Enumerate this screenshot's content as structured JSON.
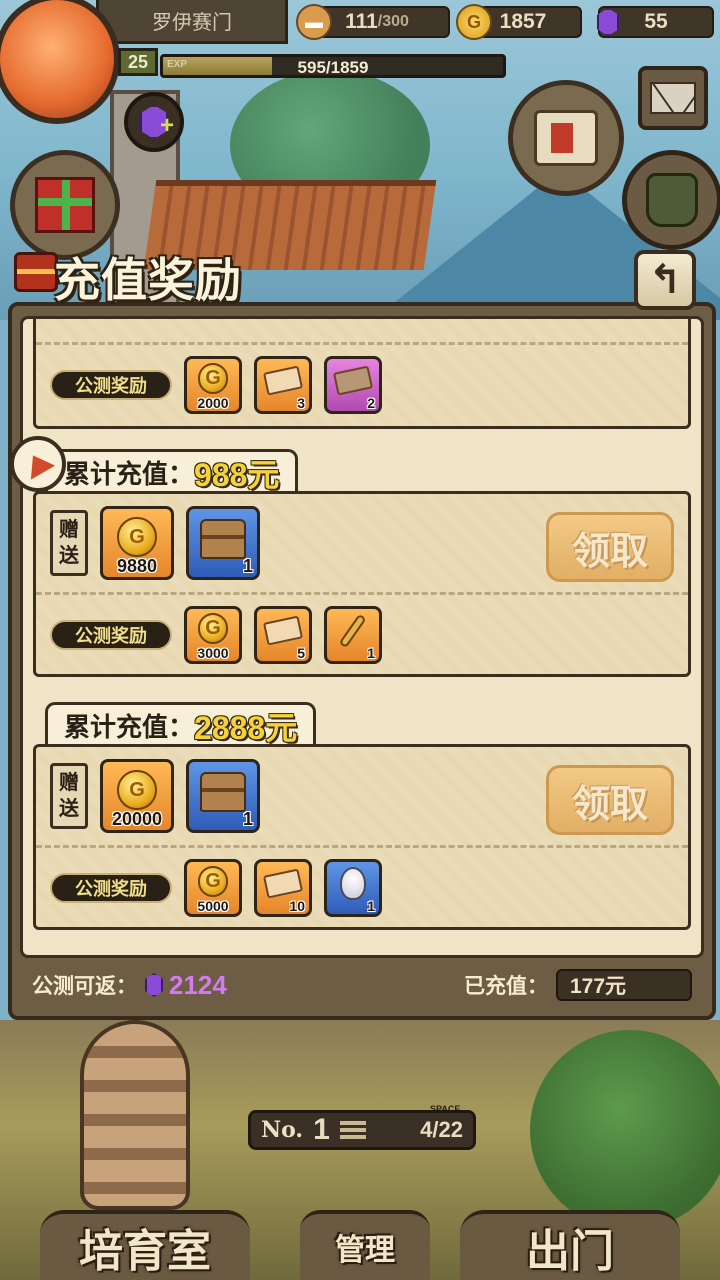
{
  "header": {
    "player_name": "罗伊赛门",
    "level": "25",
    "exp_label": "EXP",
    "exp_text": "595/1859",
    "exp_ratio": 0.32
  },
  "resources": {
    "bread": {
      "value": "111",
      "max": "/300"
    },
    "gold": {
      "value": "1857",
      "icon_text": "G"
    },
    "gems": {
      "value": "55"
    }
  },
  "dialog": {
    "title": "充值奖励",
    "back_icon": "↰"
  },
  "tiers": [
    {
      "bonus_label": "公测奖励",
      "bonus_items": [
        {
          "type": "gold",
          "frame": "orange",
          "count": "2000"
        },
        {
          "type": "ticket",
          "frame": "orange",
          "count": "3"
        },
        {
          "type": "ticket-dark",
          "frame": "purple",
          "count": "2"
        }
      ]
    },
    {
      "header_label": "累计充值：",
      "amount": "988元",
      "gift_label_1": "赠",
      "gift_label_2": "送",
      "gift_items": [
        {
          "type": "gold",
          "frame": "orange",
          "count": "9880"
        },
        {
          "type": "chest",
          "frame": "blue",
          "count": "1"
        }
      ],
      "claim_label": "领取",
      "bonus_label": "公测奖励",
      "bonus_items": [
        {
          "type": "gold",
          "frame": "orange",
          "count": "3000"
        },
        {
          "type": "ticket",
          "frame": "orange",
          "count": "5"
        },
        {
          "type": "key",
          "frame": "orange",
          "count": "1"
        }
      ]
    },
    {
      "header_label": "累计充值：",
      "amount": "2888元",
      "gift_label_1": "赠",
      "gift_label_2": "送",
      "gift_items": [
        {
          "type": "gold",
          "frame": "orange",
          "count": "20000"
        },
        {
          "type": "chest",
          "frame": "blue",
          "count": "1"
        }
      ],
      "claim_label": "领取",
      "bonus_label": "公测奖励",
      "bonus_items": [
        {
          "type": "gold",
          "frame": "orange",
          "count": "5000"
        },
        {
          "type": "ticket",
          "frame": "orange",
          "count": "10"
        },
        {
          "type": "egg",
          "frame": "blue",
          "count": "1"
        }
      ]
    }
  ],
  "footer": {
    "refund_label": "公测可返：",
    "refund_value": "2124",
    "paid_label": "已充值：",
    "paid_value": "177元"
  },
  "bottom_hud": {
    "rank_prefix": "No.",
    "rank": "1",
    "space_tag": "SPACE",
    "space": "4/22",
    "nursery_label": "培育室",
    "manage_label": "管理",
    "exit_label": "出门"
  }
}
